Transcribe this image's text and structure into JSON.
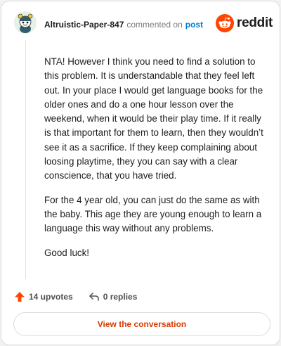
{
  "comment": {
    "author": "Altruistic-Paper-847",
    "verb": "commented on",
    "target": "post",
    "paragraphs": [
      "NTA! However I think you need to find a solution to this problem. It is understandable that they feel left out. In your place I would get language books for the older ones and do a one hour lesson over the weekend, when it would be their play time. If it really is that important for them to learn, then they wouldn’t see it as a sacrifice. If they keep complaining about loosing playtime, they you can say with a clear conscience, that you have tried.",
      "For the 4 year old, you can just do the same as with the baby. This age they are young enough to learn a language this way without any problems.",
      "Good luck!"
    ]
  },
  "brand": {
    "wordmark": "reddit",
    "icon": "reddit-logo-icon",
    "color": "#ff4500"
  },
  "actions": {
    "upvotes": "14 upvotes",
    "replies": "0 replies",
    "upvote_icon": "upvote-arrow-icon",
    "reply_icon": "reply-icon"
  },
  "cta": {
    "label": "View the conversation"
  },
  "colors": {
    "accent": "#d93a00",
    "upvote": "#ff4500",
    "link": "#0079d3"
  }
}
